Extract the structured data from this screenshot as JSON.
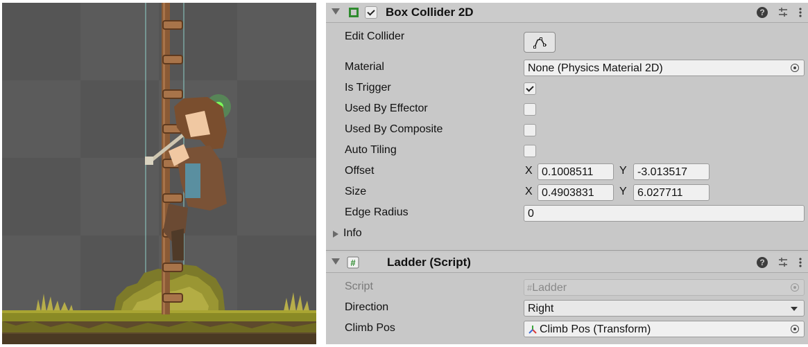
{
  "box_collider": {
    "title": "Box Collider 2D",
    "enabled": true,
    "edit_collider_label": "Edit Collider",
    "material_label": "Material",
    "material_value": "None (Physics Material 2D)",
    "is_trigger_label": "Is Trigger",
    "is_trigger": true,
    "used_by_effector_label": "Used By Effector",
    "used_by_effector": false,
    "used_by_composite_label": "Used By Composite",
    "used_by_composite": false,
    "auto_tiling_label": "Auto Tiling",
    "auto_tiling": false,
    "offset_label": "Offset",
    "offset_x": "0.1008511",
    "offset_y": "-3.013517",
    "size_label": "Size",
    "size_x": "0.4903831",
    "size_y": "6.027711",
    "edge_radius_label": "Edge Radius",
    "edge_radius": "0",
    "info_label": "Info",
    "x_label": "X",
    "y_label": "Y"
  },
  "ladder_script": {
    "title": "Ladder (Script)",
    "script_label": "Script",
    "script_value": "Ladder",
    "direction_label": "Direction",
    "direction_value": "Right",
    "climb_pos_label": "Climb Pos",
    "climb_pos_value": "Climb Pos (Transform)"
  },
  "icons": {
    "collider_icon": "box-collider-icon",
    "script_icon": "script-hash-icon",
    "help": "help-icon",
    "presets": "presets-icon",
    "menu": "kebab-menu-icon",
    "transform": "transform-icon"
  },
  "colors": {
    "inspector_bg": "#c8c8c8",
    "collider_icon": "#2e8b2e",
    "transform_x": "#d83a3a",
    "transform_y": "#3aa63a",
    "transform_z": "#3a6ad8"
  }
}
